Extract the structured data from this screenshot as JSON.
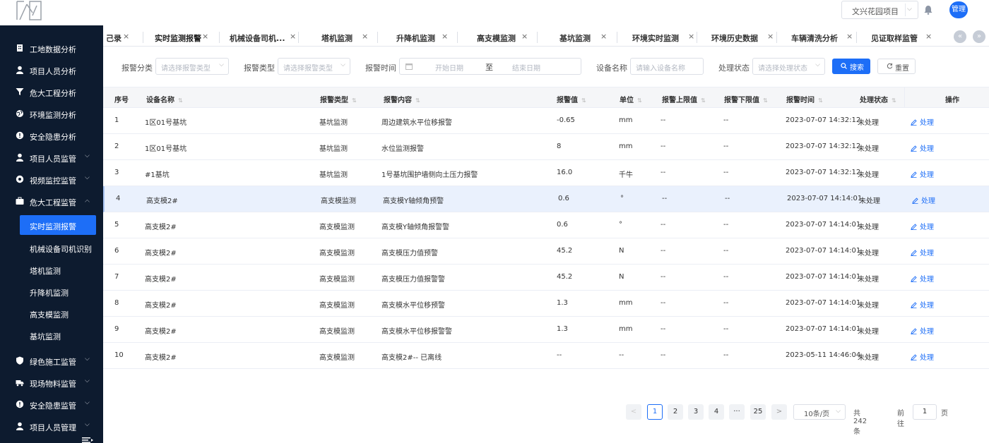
{
  "header": {
    "project": "文兴花园项目",
    "user": "管理"
  },
  "sidebar": {
    "items": [
      {
        "label": "工地数据分析"
      },
      {
        "label": "项目人员分析"
      },
      {
        "label": "危大工程分析"
      },
      {
        "label": "环境监测分析"
      },
      {
        "label": "安全隐患分析"
      },
      {
        "label": "项目人员监管"
      },
      {
        "label": "视频监控监管"
      },
      {
        "label": "危大工程监管"
      },
      {
        "label": "绿色施工监管"
      },
      {
        "label": "现场物料监管"
      },
      {
        "label": "安全隐患监管"
      },
      {
        "label": "项目人员管理"
      }
    ],
    "subitems": [
      {
        "label": "实时监测报警"
      },
      {
        "label": "机械设备司机识别"
      },
      {
        "label": "塔机监测"
      },
      {
        "label": "升降机监测"
      },
      {
        "label": "高支模监测"
      },
      {
        "label": "基坑监测"
      }
    ]
  },
  "tabs": [
    {
      "label": "己录"
    },
    {
      "label": "实时监测报警"
    },
    {
      "label": "机械设备司机..."
    },
    {
      "label": "塔机监测"
    },
    {
      "label": "升降机监测"
    },
    {
      "label": "高支模监测"
    },
    {
      "label": "基坑监测"
    },
    {
      "label": "环境实时监测"
    },
    {
      "label": "环境历史数据"
    },
    {
      "label": "车辆清洗分析"
    },
    {
      "label": "见证取样监管"
    }
  ],
  "filters": {
    "alarm_category_label": "报警分类",
    "alarm_category_placeholder": "请选择报警类型",
    "alarm_type_label": "报警类型",
    "alarm_type_placeholder": "请选择报警类型",
    "alarm_time_label": "报警时间",
    "start_placeholder": "开始日期",
    "range_sep": "至",
    "end_placeholder": "结束日期",
    "device_label": "设备名称",
    "device_placeholder": "请输入设备名称",
    "status_label": "处理状态",
    "status_placeholder": "请选择处理状态",
    "search": "搜索",
    "reset": "重置"
  },
  "table": {
    "columns": [
      "序号",
      "设备名称",
      "报警类型",
      "报警内容",
      "报警值",
      "单位",
      "报警上限值",
      "报警下限值",
      "报警时间",
      "处理状态",
      "操作"
    ],
    "rows": [
      {
        "no": "1",
        "device": "1区01号基坑",
        "type": "基坑监测",
        "content": "周边建筑水平位移报警",
        "value": "-0.65",
        "unit": "mm",
        "upper": "--",
        "lower": "--",
        "time": "2023-07-07 14:32:12",
        "status": "未处理",
        "action": "处理"
      },
      {
        "no": "2",
        "device": "1区01号基坑",
        "type": "基坑监测",
        "content": "水位监测报警",
        "value": "8",
        "unit": "mm",
        "upper": "--",
        "lower": "--",
        "time": "2023-07-07 14:32:12",
        "status": "未处理",
        "action": "处理"
      },
      {
        "no": "3",
        "device": "#1基坑",
        "type": "基坑监测",
        "content": "1号基坑围护墙侧向土压力报警",
        "value": "16.0",
        "unit": "千牛",
        "upper": "--",
        "lower": "--",
        "time": "2023-07-07 14:32:12",
        "status": "未处理",
        "action": "处理"
      },
      {
        "no": "4",
        "device": "高支模2#",
        "type": "高支模监测",
        "content": "高支模Y轴倾角预警",
        "value": "0.6",
        "unit": "°",
        "upper": "--",
        "lower": "--",
        "time": "2023-07-07 14:14:01",
        "status": "未处理",
        "action": "处理"
      },
      {
        "no": "5",
        "device": "高支模2#",
        "type": "高支模监测",
        "content": "高支模Y轴倾角报警警",
        "value": "0.6",
        "unit": "°",
        "upper": "--",
        "lower": "--",
        "time": "2023-07-07 14:14:01",
        "status": "未处理",
        "action": "处理"
      },
      {
        "no": "6",
        "device": "高支模2#",
        "type": "高支模监测",
        "content": "高支模压力值预警",
        "value": "45.2",
        "unit": "N",
        "upper": "--",
        "lower": "--",
        "time": "2023-07-07 14:14:01",
        "status": "未处理",
        "action": "处理"
      },
      {
        "no": "7",
        "device": "高支模2#",
        "type": "高支模监测",
        "content": "高支模压力值报警警",
        "value": "45.2",
        "unit": "N",
        "upper": "--",
        "lower": "--",
        "time": "2023-07-07 14:14:01",
        "status": "未处理",
        "action": "处理"
      },
      {
        "no": "8",
        "device": "高支模2#",
        "type": "高支模监测",
        "content": "高支模水平位移预警",
        "value": "1.3",
        "unit": "mm",
        "upper": "--",
        "lower": "--",
        "time": "2023-07-07 14:14:01",
        "status": "未处理",
        "action": "处理"
      },
      {
        "no": "9",
        "device": "高支模2#",
        "type": "高支模监测",
        "content": "高支模水平位移报警警",
        "value": "1.3",
        "unit": "mm",
        "upper": "--",
        "lower": "--",
        "time": "2023-07-07 14:14:01",
        "status": "未处理",
        "action": "处理"
      },
      {
        "no": "10",
        "device": "高支模2#",
        "type": "高支模监测",
        "content": "高支模2#-- 已离线",
        "value": "--",
        "unit": "--",
        "upper": "--",
        "lower": "--",
        "time": "2023-05-11 14:46:04",
        "status": "未处理",
        "action": "处理"
      }
    ]
  },
  "pagination": {
    "prev": "<",
    "pages": [
      "1",
      "2",
      "3",
      "4",
      "···",
      "25"
    ],
    "next": ">",
    "page_size": "10条/页",
    "total": "共 242 条",
    "goto_label": "前往",
    "goto_value": "1",
    "goto_unit": "页"
  },
  "icons": {
    "tab_close": "×",
    "tab_prev": "«",
    "tab_next": "»",
    "chevron": "⌵"
  },
  "colors": {
    "accent": "#1d6ef7",
    "sidebar_bg": "#0d1b2f",
    "hover_row": "#eaf1fd"
  }
}
